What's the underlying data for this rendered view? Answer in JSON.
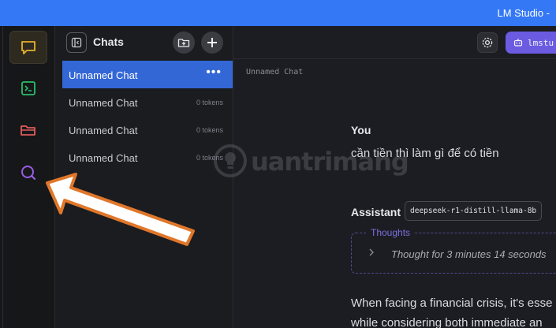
{
  "window": {
    "title": "LM Studio -"
  },
  "rail": {
    "items": [
      {
        "icon": "chat-bubble-icon",
        "active": true,
        "color": "#e8b22c"
      },
      {
        "icon": "terminal-icon",
        "active": false,
        "color": "#28c06a"
      },
      {
        "icon": "folder-icon",
        "active": false,
        "color": "#e05b5b"
      },
      {
        "icon": "search-icon",
        "active": false,
        "color": "#9a5de6"
      }
    ]
  },
  "sidebar": {
    "title": "Chats",
    "chats": [
      {
        "name": "Unnamed Chat",
        "selected": true,
        "more": "•••"
      },
      {
        "name": "Unnamed Chat",
        "tokens": "0 tokens"
      },
      {
        "name": "Unnamed Chat",
        "tokens": "0 tokens"
      },
      {
        "name": "Unnamed Chat",
        "tokens": "0 tokens"
      }
    ]
  },
  "main": {
    "chat_name": "Unnamed Chat",
    "load_button": "lmstu",
    "user": {
      "label": "You",
      "message": "cần tiền thì làm gì để có tiền"
    },
    "assistant": {
      "label": "Assistant",
      "model": "deepseek-r1-distill-llama-8b",
      "thoughts_label": "Thoughts",
      "thoughts_summary": "Thought for 3 minutes 14 seconds",
      "response_lines": [
        "When facing a financial crisis, it's esse",
        "while considering both immediate an"
      ]
    }
  },
  "watermark": {
    "text": "uantrimang"
  },
  "colors": {
    "accent": "#3478f6",
    "selected_chat": "#3467d6",
    "load_button": "#6a5be0",
    "arrow_fill": "#ffffff",
    "arrow_stroke": "#e0772a"
  }
}
